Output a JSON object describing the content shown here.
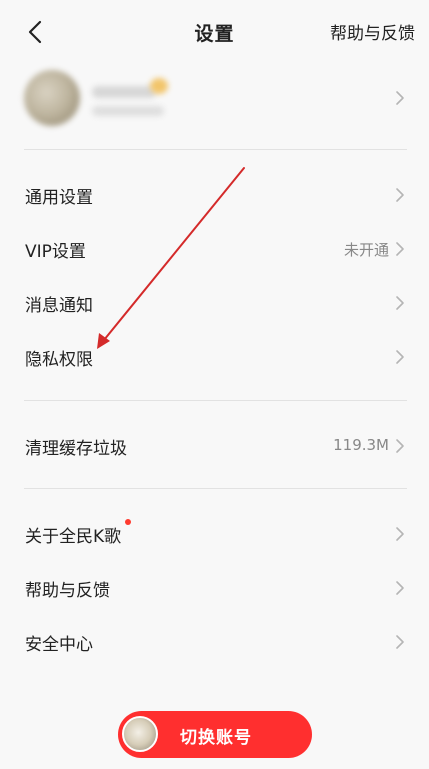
{
  "header": {
    "title": "设置",
    "help_label": "帮助与反馈"
  },
  "group1": [
    {
      "label": "通用设置",
      "value": ""
    },
    {
      "label": "VIP设置",
      "value": "未开通"
    },
    {
      "label": "消息通知",
      "value": ""
    },
    {
      "label": "隐私权限",
      "value": ""
    }
  ],
  "group2": [
    {
      "label": "清理缓存垃圾",
      "value": "119.3M"
    }
  ],
  "group3": [
    {
      "label": "关于全民K歌",
      "value": ""
    },
    {
      "label": "帮助与反馈",
      "value": ""
    },
    {
      "label": "安全中心",
      "value": ""
    }
  ],
  "switch_account": {
    "label": "切换账号"
  },
  "colors": {
    "accent": "#ff2f2f",
    "arrow": "#d42a2a",
    "background": "#f8f8f8"
  },
  "icons": {
    "back": "chevron-left-icon",
    "row": "chevron-right-icon"
  }
}
